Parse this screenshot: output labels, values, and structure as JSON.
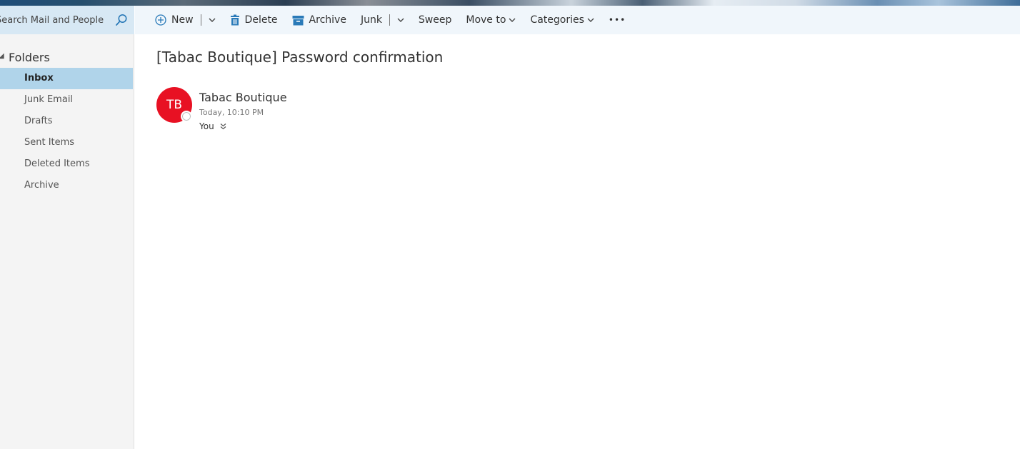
{
  "search": {
    "placeholder": "Search Mail and People",
    "icon": "search-icon"
  },
  "folders": {
    "title": "Folders",
    "items": [
      {
        "label": "Inbox",
        "active": true
      },
      {
        "label": "Junk Email"
      },
      {
        "label": "Drafts"
      },
      {
        "label": "Sent Items"
      },
      {
        "label": "Deleted Items"
      },
      {
        "label": "Archive"
      }
    ]
  },
  "toolbar": {
    "new_label": "New",
    "delete_label": "Delete",
    "archive_label": "Archive",
    "junk_label": "Junk",
    "sweep_label": "Sweep",
    "move_label": "Move to",
    "categories_label": "Categories",
    "more_label": "•••"
  },
  "message": {
    "subject": "[Tabac Boutique] Password confirmation",
    "avatar_initials": "TB",
    "avatar_color": "#e81123",
    "sender": "Tabac Boutique",
    "timestamp": "Today, 10:10 PM",
    "recipient": "You"
  },
  "colors": {
    "accent": "#0078d7",
    "sidebar_active": "#b0d4ea",
    "search_bg": "#d7e8f4",
    "toolbar_bg": "#f0f6fb"
  }
}
